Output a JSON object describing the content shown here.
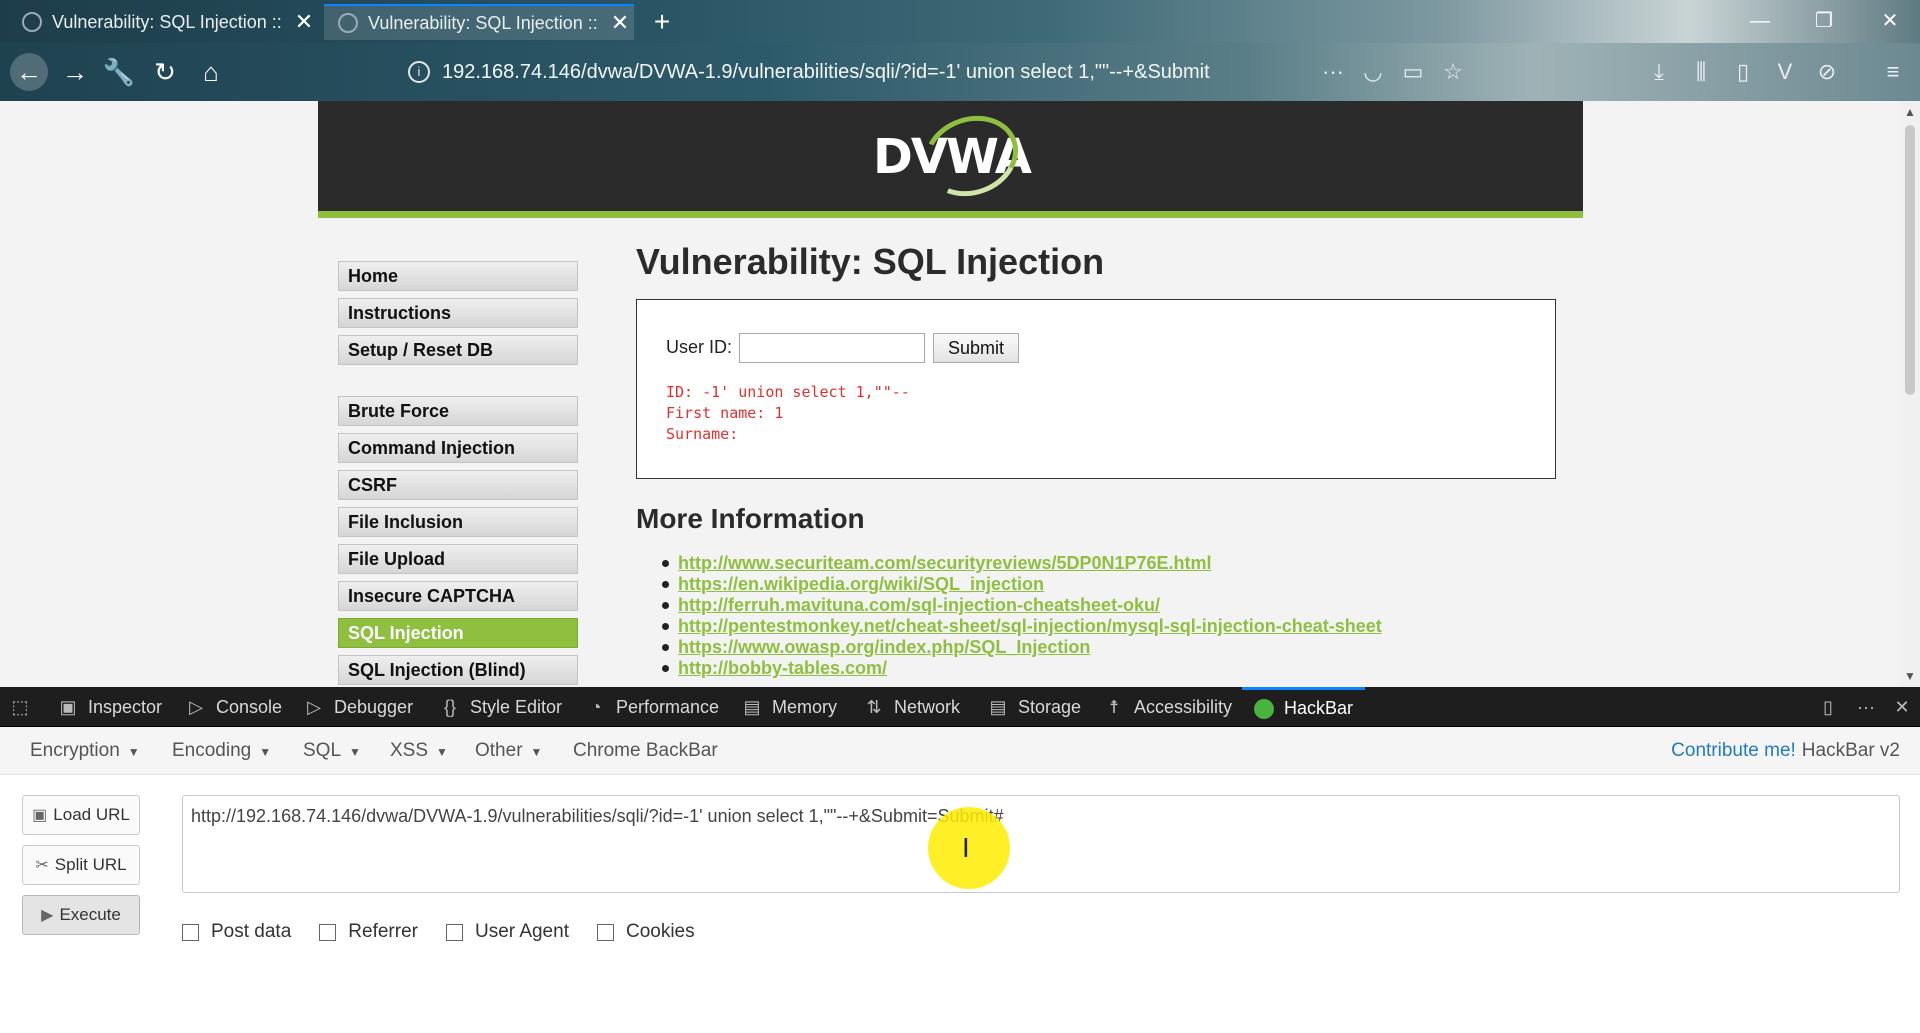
{
  "browser": {
    "tabs": [
      {
        "title": "Vulnerability: SQL Injection :: "
      },
      {
        "title": "Vulnerability: SQL Injection :: "
      }
    ],
    "url": "192.168.74.146/dvwa/DVWA-1.9/vulnerabilities/sqli/?id=-1' union select 1,\"\"--+&Submit"
  },
  "dvwa": {
    "logo_text": "DVWA",
    "menu": {
      "group1": [
        "Home",
        "Instructions",
        "Setup / Reset DB"
      ],
      "group2": [
        "Brute Force",
        "Command Injection",
        "CSRF",
        "File Inclusion",
        "File Upload",
        "Insecure CAPTCHA",
        "SQL Injection",
        "SQL Injection (Blind)"
      ],
      "selected": "SQL Injection"
    },
    "title": "Vulnerability: SQL Injection",
    "form": {
      "user_id_label": "User ID:",
      "user_id_value": "",
      "submit_label": "Submit"
    },
    "result_lines": [
      "ID: -1' union select 1,\"\"--",
      "First name: 1",
      "Surname:"
    ],
    "more_info_title": "More Information",
    "links": [
      "http://www.securiteam.com/securityreviews/5DP0N1P76E.html",
      "https://en.wikipedia.org/wiki/SQL_injection",
      "http://ferruh.mavituna.com/sql-injection-cheatsheet-oku/",
      "http://pentestmonkey.net/cheat-sheet/sql-injection/mysql-sql-injection-cheat-sheet",
      "https://www.owasp.org/index.php/SQL_Injection",
      "http://bobby-tables.com/"
    ]
  },
  "devtools": {
    "tabs": [
      "Inspector",
      "Console",
      "Debugger",
      "Style Editor",
      "Performance",
      "Memory",
      "Network",
      "Storage",
      "Accessibility",
      "HackBar"
    ],
    "active_tab": "HackBar"
  },
  "hackbar": {
    "menus": [
      "Encryption",
      "Encoding",
      "SQL",
      "XSS",
      "Other",
      "Chrome BackBar"
    ],
    "contribute_link": "Contribute me!",
    "version": "HackBar v2",
    "buttons": {
      "load": "Load URL",
      "split": "Split URL",
      "execute": "Execute"
    },
    "url_value": "http://192.168.74.146/dvwa/DVWA-1.9/vulnerabilities/sqli/?id=-1' union select 1,\"\"--+&Submit=Submit#",
    "options": [
      "Post data",
      "Referrer",
      "User Agent",
      "Cookies"
    ]
  },
  "colors": {
    "dvwa_green": "#8fbf3f",
    "error_red": "#e0312b",
    "link_blue": "#1e7bc4"
  }
}
